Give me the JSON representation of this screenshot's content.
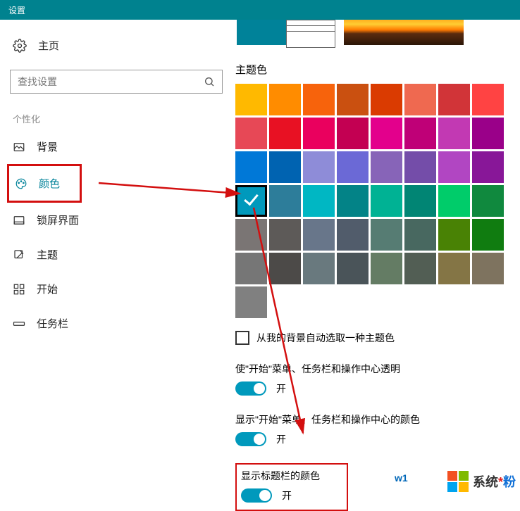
{
  "titlebar": {
    "title": "设置"
  },
  "sidebar": {
    "home": "主页",
    "search_placeholder": "查找设置",
    "section": "个性化",
    "items": [
      {
        "label": "背景"
      },
      {
        "label": "颜色"
      },
      {
        "label": "锁屏界面"
      },
      {
        "label": "主题"
      },
      {
        "label": "开始"
      },
      {
        "label": "任务栏"
      }
    ]
  },
  "content": {
    "accent_heading": "主题色",
    "palette": [
      [
        "#ffb900",
        "#ff8c00",
        "#f7630c",
        "#ca5010",
        "#da3b01",
        "#ef6950",
        "#d13438",
        "#ff4343"
      ],
      [
        "#e74856",
        "#e81123",
        "#ea005e",
        "#c30052",
        "#e3008c",
        "#bf0077",
        "#c239b3",
        "#9a0089"
      ],
      [
        "#0078d7",
        "#0063b1",
        "#8e8cd8",
        "#6b69d6",
        "#8764b8",
        "#744da9",
        "#b146c2",
        "#881798"
      ],
      [
        "#0099bc",
        "#2d7d9a",
        "#00b7c3",
        "#038387",
        "#00b294",
        "#018574",
        "#00cc6a",
        "#10893e"
      ],
      [
        "#7a7574",
        "#5d5a58",
        "#68768a",
        "#515c6b",
        "#567c73",
        "#486860",
        "#498205",
        "#107c10"
      ],
      [
        "#767676",
        "#4c4a48",
        "#69797e",
        "#4a5459",
        "#647c64",
        "#525e54",
        "#847545",
        "#7e735f"
      ]
    ],
    "extra_swatch": "#808080",
    "selected": {
      "row": 3,
      "col": 0
    },
    "auto_checkbox": "从我的背景自动选取一种主题色",
    "options": [
      {
        "label": "使\"开始\"菜单、任务栏和操作中心透明",
        "state": "开",
        "on": true
      },
      {
        "label": "显示\"开始\"菜单、任务栏和操作中心的颜色",
        "state": "开",
        "on": true
      },
      {
        "label": "显示标题栏的颜色",
        "state": "开",
        "on": true
      }
    ]
  },
  "watermark": {
    "text_a": "系统",
    "text_b": "粉",
    "link": "w1"
  }
}
